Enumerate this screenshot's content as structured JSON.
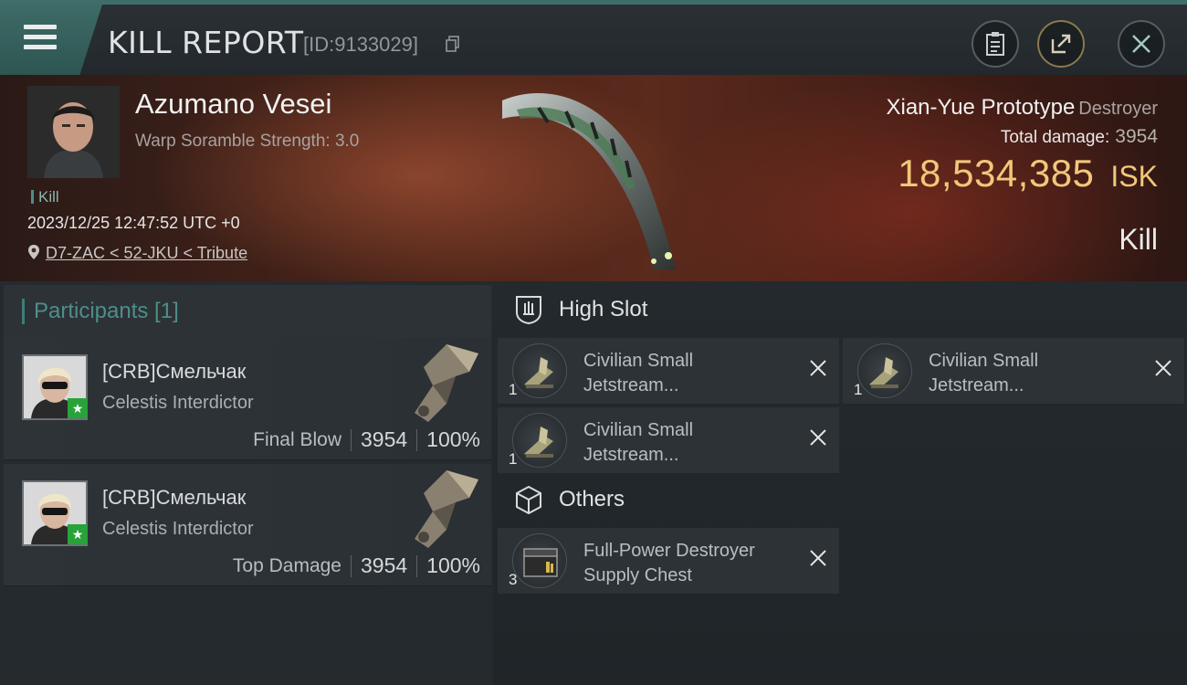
{
  "header": {
    "title": "KILL REPORT",
    "report_id": "[ID:9133029]"
  },
  "victim": {
    "name": "Azumano Vesei",
    "warp_scramble": "Warp Soramble Strength: 3.0",
    "tag": "Kill",
    "datetime": "2023/12/25 12:47:52 UTC +0",
    "location": "D7-ZAC < 52-JKU < Tribute",
    "ship_name": "Xian-Yue Prototype",
    "ship_class": "Destroyer",
    "total_damage_label": "Total damage:",
    "total_damage": "3954",
    "isk_value": "18,534,385",
    "isk_unit": "ISK",
    "result": "Kill"
  },
  "participants": {
    "title": "Participants [1]",
    "items": [
      {
        "name": "[CRB]Смельчак",
        "ship": "Celestis Interdictor",
        "role": "Final Blow",
        "damage": "3954",
        "percent": "100%"
      },
      {
        "name": "[CRB]Смельчак",
        "ship": "Celestis Interdictor",
        "role": "Top Damage",
        "damage": "3954",
        "percent": "100%"
      }
    ]
  },
  "high_slot": {
    "title": "High Slot",
    "items": [
      {
        "name": "Civilian Small Jetstream...",
        "qty": "1"
      },
      {
        "name": "Civilian Small Jetstream...",
        "qty": "1"
      },
      {
        "name": "Civilian Small Jetstream...",
        "qty": "1"
      }
    ]
  },
  "others": {
    "title": "Others",
    "items": [
      {
        "name": "Full-Power Destroyer Supply Chest",
        "qty": "3"
      }
    ]
  },
  "colors": {
    "accent_teal": "#3f6e6a",
    "isk_gold": "#f2c77a",
    "corp_star": "#27a33a"
  }
}
